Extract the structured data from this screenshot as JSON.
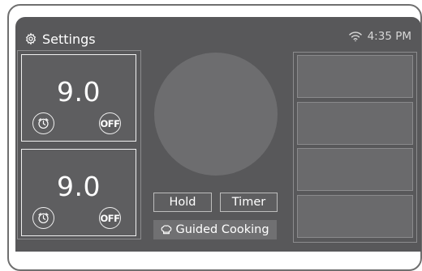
{
  "header": {
    "settings_label": "Settings",
    "time": "4:35 PM",
    "settings_icon": "gear-icon",
    "wifi_icon": "wifi-icon"
  },
  "zones": [
    {
      "temperature": "9.0",
      "off_label": "OFF",
      "timer_icon": "clock-icon"
    },
    {
      "temperature": "9.0",
      "off_label": "OFF",
      "timer_icon": "clock-icon"
    }
  ],
  "center": {
    "dial_icon": "dial-icon",
    "hold_label": "Hold",
    "timer_label": "Timer",
    "guided_label": "Guided Cooking",
    "guided_icon": "chef-hat-icon"
  },
  "right_slots": [
    "",
    "",
    "",
    ""
  ],
  "colors": {
    "screen": "#58585a",
    "panel": "#5e5e60",
    "dial": "#6d6d6f",
    "text": "#ffffff"
  }
}
